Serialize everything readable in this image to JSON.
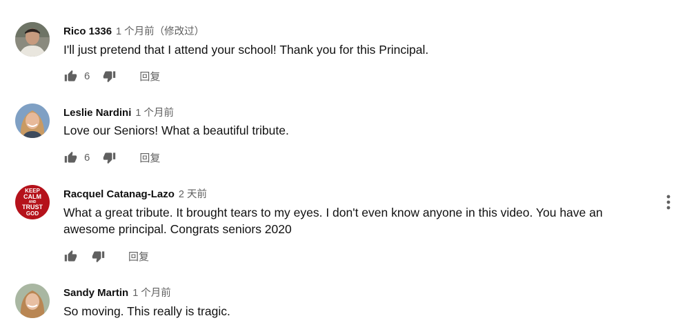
{
  "comments": [
    {
      "author": "Rico 1336",
      "time": "1 个月前（修改过）",
      "text": "I'll just pretend that I attend your school! Thank you for this Principal.",
      "likes": "6",
      "reply": "回复"
    },
    {
      "author": "Leslie Nardini",
      "time": "1 个月前",
      "text": "Love our Seniors!  What a beautiful tribute.",
      "likes": "6",
      "reply": "回复"
    },
    {
      "author": "Racquel Catanag-Lazo",
      "time": "2 天前",
      "text": "What a great tribute.  It brought tears to my eyes.  I don't even know anyone in this video.  You have an awesome principal. Congrats seniors 2020",
      "likes": "",
      "reply": "回复",
      "avatar_text": [
        "KEEP",
        "CALM",
        "AND",
        "TRUST",
        "GOD"
      ]
    },
    {
      "author": "Sandy Martin",
      "time": "1 个月前",
      "text": "So moving.  This really is tragic.",
      "likes": "",
      "reply": ""
    }
  ],
  "icons": {
    "like": "thumb-up-icon",
    "dislike": "thumb-down-icon",
    "menu": "more-vert-icon"
  },
  "colors": {
    "secondary_text": "#606060",
    "avatar_keep_calm_bg": "#b5121b"
  }
}
